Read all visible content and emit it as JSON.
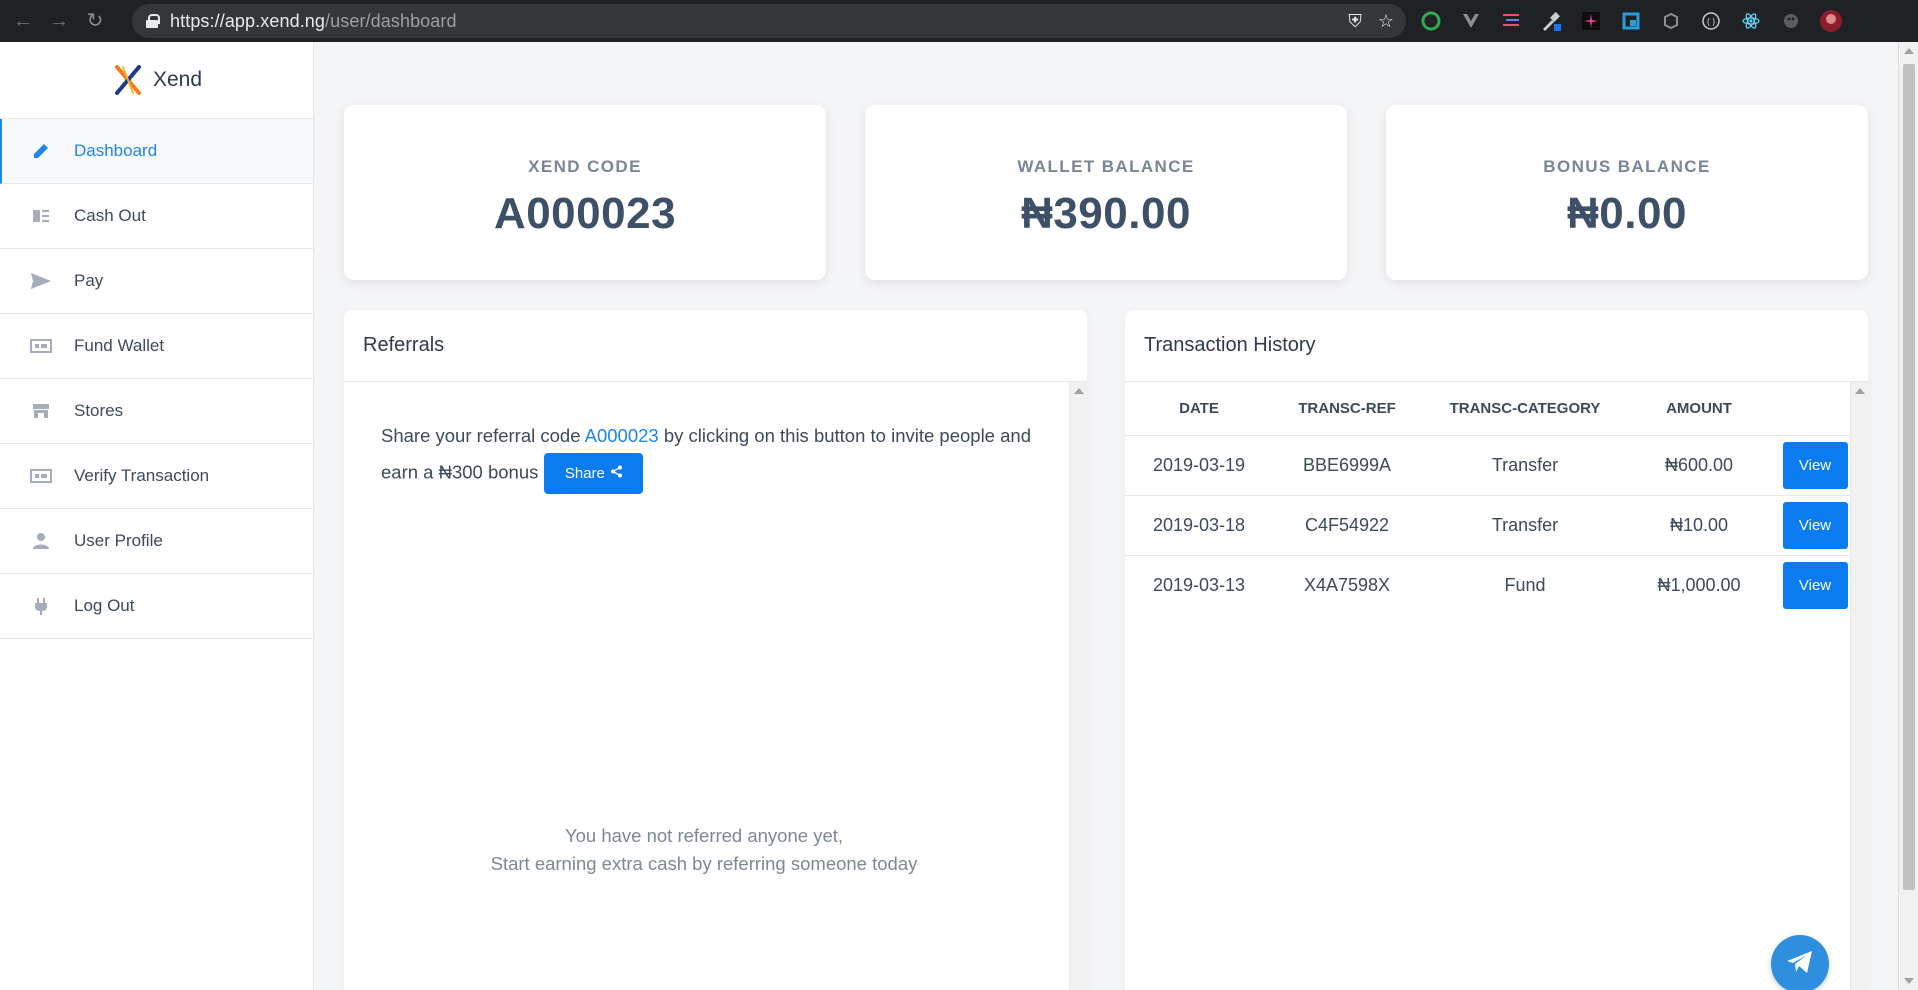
{
  "browser": {
    "url_host": "https://app.xend.ng",
    "url_path": "/user/dashboard"
  },
  "brand": {
    "name": "Xend"
  },
  "sidebar": {
    "items": [
      {
        "label": "Dashboard",
        "icon": "pencil-icon",
        "active": true
      },
      {
        "label": "Cash Out",
        "icon": "cash-out-icon"
      },
      {
        "label": "Pay",
        "icon": "send-icon"
      },
      {
        "label": "Fund Wallet",
        "icon": "wallet-icon"
      },
      {
        "label": "Stores",
        "icon": "store-icon"
      },
      {
        "label": "Verify Transaction",
        "icon": "receipt-icon"
      },
      {
        "label": "User Profile",
        "icon": "user-icon"
      },
      {
        "label": "Log Out",
        "icon": "plug-icon"
      }
    ]
  },
  "stats": [
    {
      "label": "XEND CODE",
      "value": "A000023"
    },
    {
      "label": "WALLET BALANCE",
      "value": "₦390.00"
    },
    {
      "label": "BONUS BALANCE",
      "value": "₦0.00"
    }
  ],
  "referrals": {
    "title": "Referrals",
    "text_before": "Share your referral code ",
    "code": "A000023",
    "text_after": " by clicking on this button to invite people and earn a ₦300 bonus",
    "share_label": "Share",
    "empty_line1": "You have not referred anyone yet,",
    "empty_line2": "Start earning extra cash by referring someone today"
  },
  "transactions": {
    "title": "Transaction History",
    "columns": [
      "DATE",
      "TRANSC-REF",
      "TRANSC-CATEGORY",
      "AMOUNT"
    ],
    "view_label": "View",
    "rows": [
      {
        "date": "2019-03-19",
        "ref": "BBE6999A",
        "category": "Transfer",
        "amount": "₦600.00",
        "type": "debit"
      },
      {
        "date": "2019-03-18",
        "ref": "C4F54922",
        "category": "Transfer",
        "amount": "₦10.00",
        "type": "debit"
      },
      {
        "date": "2019-03-13",
        "ref": "X4A7598X",
        "category": "Fund",
        "amount": "₦1,000.00",
        "type": "credit"
      }
    ]
  },
  "colors": {
    "accent": "#0a7cf0",
    "debit": "#e01b24",
    "credit": "#1a8a1a"
  }
}
